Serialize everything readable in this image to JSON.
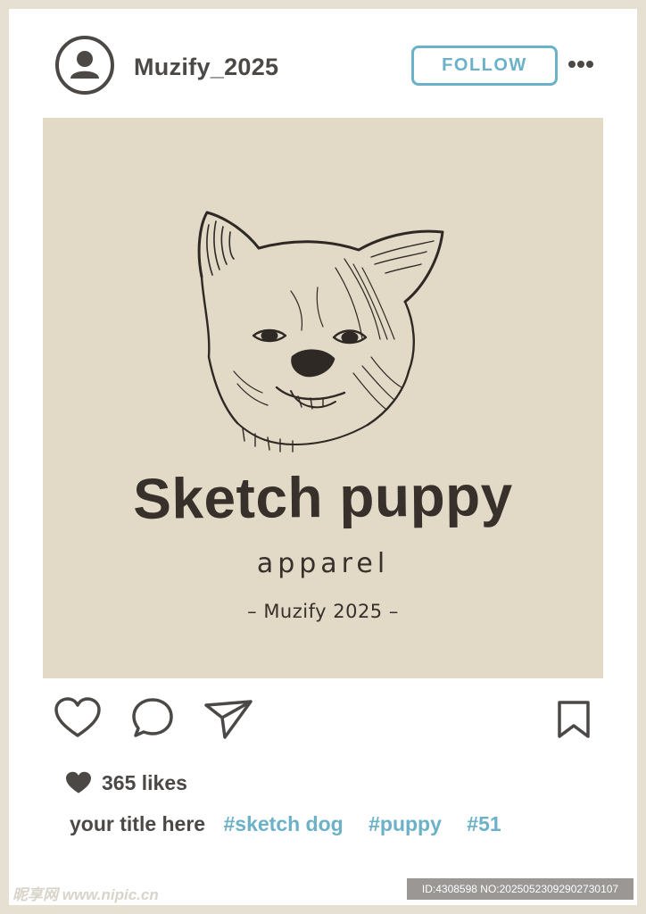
{
  "post": {
    "username": "Muzify_2025",
    "follow_label": "FOLLOW",
    "more_icon": "more-dots-icon",
    "avatar_icon": "user-avatar-icon"
  },
  "image": {
    "brand_title": "Sketch puppy",
    "brand_subtitle": "apparel",
    "brand_tagline": "– Muzify 2025 –",
    "background_color": "#e2d9c6",
    "illustration": "sketch-dog-head"
  },
  "actions": {
    "like_icon": "heart-outline-icon",
    "comment_icon": "comment-bubble-icon",
    "share_icon": "paper-plane-icon",
    "bookmark_icon": "bookmark-icon"
  },
  "likes": {
    "count_label": "365 likes",
    "icon": "heart-filled-icon"
  },
  "caption": {
    "title": "your title here",
    "hashtags": [
      "#sketch dog",
      "#puppy",
      "#51"
    ]
  },
  "watermark": {
    "left": "昵享网 www.nipic.cn",
    "right": "ID:4308598 NO:20250523092902730107"
  },
  "colors": {
    "accent": "#6bb1c7",
    "text": "#4b4845",
    "frame": "#e6e0d2"
  }
}
